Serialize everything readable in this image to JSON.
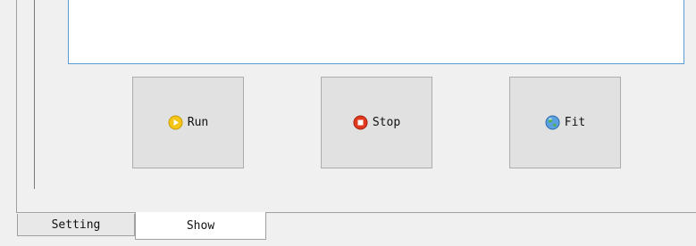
{
  "toolbar": {
    "run_label": "Run",
    "stop_label": "Stop",
    "fit_label": "Fit",
    "run_icon": "play-circle-icon",
    "stop_icon": "stop-circle-icon",
    "fit_icon": "globe-icon"
  },
  "tabs": [
    {
      "label": "Setting",
      "active": false
    },
    {
      "label": "Show",
      "active": true
    }
  ],
  "colors": {
    "display_border": "#5b9bd5",
    "run_icon": "#f5c518",
    "stop_icon": "#e03a1e",
    "fit_icon": "#3b82c4"
  }
}
